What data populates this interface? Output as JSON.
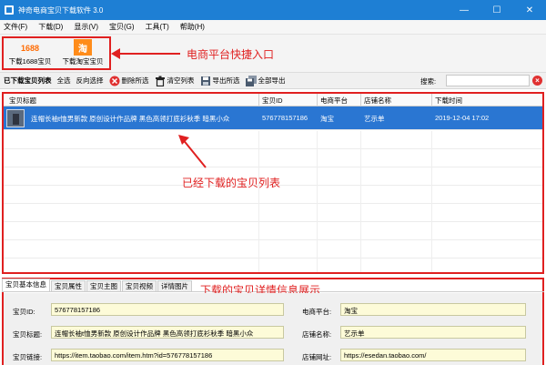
{
  "window": {
    "title": "神奇电商宝贝下载软件 3.0",
    "controls": [
      "—",
      "☐",
      "✕"
    ]
  },
  "menu": [
    "文件(F)",
    "下载(D)",
    "显示(V)",
    "宝贝(G)",
    "工具(T)",
    "帮助(H)"
  ],
  "quick": {
    "item1": {
      "icon_text": "1688",
      "label": "下载1688宝贝"
    },
    "item2": {
      "icon_text": "淘",
      "label": "下载淘宝宝贝"
    }
  },
  "annotations": {
    "quick_entry": "电商平台快捷入口",
    "list": "已经下载的宝贝列表",
    "detail": "下载的宝贝详情信息展示"
  },
  "toolbar": {
    "downloaded_list": "已下载宝贝列表",
    "select_all": "全选",
    "invert": "反向选择",
    "delete_selected": "删除所选",
    "clear_list": "清空列表",
    "export_selected": "导出所选",
    "export_all": "全部导出",
    "search_label": "搜索:",
    "search_value": ""
  },
  "table": {
    "columns": [
      "宝贝标题",
      "宝贝ID",
      "电商平台",
      "店铺名称",
      "下载时间"
    ],
    "rows": [
      {
        "title": "连帽长袖t恤男新款 原创设计作品牌 黑色高领打底衫秋季 暗黑小众",
        "id": "576778157186",
        "platform": "淘宝",
        "shop": "艺示单",
        "time": "2019-12-04 17:02"
      }
    ]
  },
  "tabs": [
    "宝贝基本信息",
    "宝贝属性",
    "宝贝主图",
    "宝贝视频",
    "详情图片"
  ],
  "detail": {
    "id_label": "宝贝ID:",
    "id_value": "576778157186",
    "title_label": "宝贝标题:",
    "title_value": "连帽长袖t恤男新款 原创设计作品牌 黑色高领打底衫秋季 暗黑小众",
    "link_label": "宝贝链接:",
    "link_value": "https://item.taobao.com/item.htm?id=576778157186",
    "platform_label": "电商平台:",
    "platform_value": "淘宝",
    "shop_label": "店铺名称:",
    "shop_value": "艺示单",
    "url_label": "店铺网址:",
    "url_value": "https://esedan.taobao.com/"
  },
  "colors": {
    "titlebar": "#1e7fd4",
    "selection": "#2a76d2",
    "annotation": "#e02020"
  }
}
